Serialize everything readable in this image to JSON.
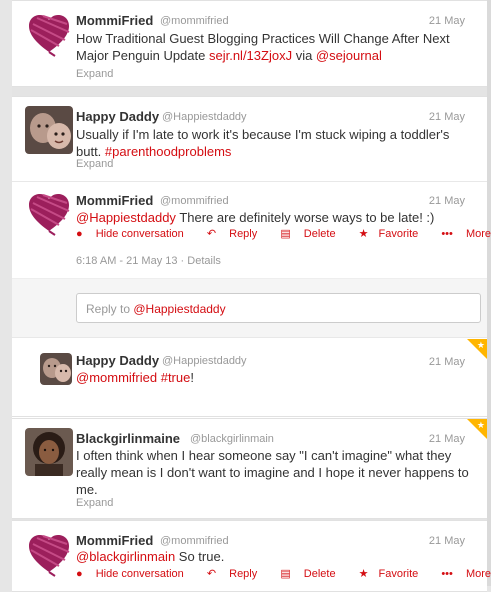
{
  "tweets": [
    {
      "name": "MommiFried",
      "handle": "@mommifried",
      "time": "21 May",
      "text_pre": "How Traditional Guest Blogging Practices Will Change After Next Major Penguin Update ",
      "text_link": "sejr.nl/13ZjoxJ",
      "text_mid": " via ",
      "text_mention": "@sejournal",
      "expand": "Expand"
    },
    {
      "name": "Happy Daddy",
      "handle": "@Happiestdaddy",
      "time": "21 May",
      "text_pre": "Usually if I'm late to work it's because I'm stuck wiping a toddler's butt. ",
      "text_hashtag": "#parenthoodproblems",
      "expand": "Expand"
    },
    {
      "name": "MommiFried",
      "handle": "@mommifried",
      "time": "21 May",
      "text_mention": "@Happiestdaddy",
      "text_post": " There are definitely worse ways to be late! :)",
      "actions": {
        "hide": "Hide conversation",
        "reply": "Reply",
        "delete": "Delete",
        "favorite": "Favorite",
        "more": "More"
      },
      "timestamp": "6:18 AM - 21 May 13",
      "details": "Details"
    },
    {
      "name": "Happy Daddy",
      "handle": "@Happiestdaddy",
      "time": "21 May",
      "text_mention": "@mommifried",
      "text_hashtag": "#true",
      "text_post": "!"
    },
    {
      "name": "Blackgirlinmaine",
      "handle": "@blackgirlinmain",
      "time": "21 May",
      "text": "I often think when I hear someone say \"I can't imagine\" what they really mean is I don't want to imagine and I hope it never happens to me.",
      "expand": "Expand"
    },
    {
      "name": "MommiFried",
      "handle": "@mommifried",
      "time": "21 May",
      "text_mention": "@blackgirlinmain",
      "text_post": " So true.",
      "actions": {
        "hide": "Hide conversation",
        "reply": "Reply",
        "delete": "Delete",
        "favorite": "Favorite",
        "more": "More"
      }
    }
  ],
  "reply_box": {
    "prefix": "Reply to ",
    "mention": "@Happiestdaddy"
  },
  "colors": {
    "accent": "#d40d12",
    "muted": "#999999",
    "text": "#333333",
    "favorite_corner": "#ffb500"
  }
}
